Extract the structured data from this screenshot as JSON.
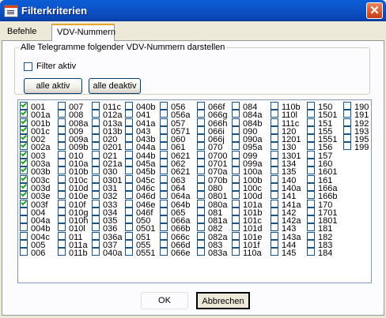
{
  "window": {
    "title": "Filterkriterien"
  },
  "tabs": [
    {
      "label": "Befehle"
    },
    {
      "label": "VDV-Nummern"
    }
  ],
  "group": {
    "label": "Alle Telegramme folgender VDV-Nummern darstellen",
    "filter_label": "Filter aktiv",
    "filter_checked": false,
    "all_on_label": "alle aktiv",
    "all_off_label": "alle deaktiv"
  },
  "vdv_columns": [
    {
      "items": [
        "001",
        "001a",
        "001b",
        "001c",
        "002",
        "002a",
        "003",
        "003a",
        "003b",
        "003c",
        "003d",
        "003e",
        "003f",
        "004",
        "004a",
        "004b",
        "004c",
        "005",
        "006"
      ],
      "checked": 13
    },
    {
      "items": [
        "007",
        "008",
        "008a",
        "009",
        "009a",
        "009b",
        "010",
        "010a",
        "010b",
        "010c",
        "010d",
        "010e",
        "010f",
        "010g",
        "010h",
        "010l",
        "011",
        "011a",
        "011b"
      ],
      "checked": 0
    },
    {
      "items": [
        "011c",
        "012a",
        "013a",
        "013b",
        "020",
        "0201",
        "021",
        "021a",
        "030",
        "0301",
        "031",
        "032",
        "033",
        "034",
        "035",
        "036",
        "036a",
        "037",
        "040a"
      ],
      "checked": 0
    },
    {
      "items": [
        "040b",
        "041",
        "041a",
        "043",
        "043b",
        "044a",
        "044b",
        "045a",
        "045b",
        "045c",
        "046c",
        "046d",
        "046e",
        "046f",
        "050",
        "0501",
        "051",
        "055",
        "0551"
      ],
      "checked": 0
    },
    {
      "items": [
        "056",
        "056a",
        "057",
        "0571",
        "060",
        "061",
        "0621",
        "062",
        "0621",
        "063",
        "064",
        "064a",
        "064b",
        "065",
        "066a",
        "066b",
        "066c",
        "066d",
        "066e"
      ],
      "checked": 0
    },
    {
      "items": [
        "066f",
        "066g",
        "066h",
        "066i",
        "066j",
        "070",
        "0700",
        "0701",
        "070a",
        "070b",
        "080",
        "0801",
        "080a",
        "081",
        "081a",
        "082",
        "082a",
        "083",
        "083a"
      ],
      "checked": 0
    },
    {
      "items": [
        "084",
        "084a",
        "084b",
        "090",
        "090a",
        "095a",
        "099",
        "099a",
        "100a",
        "100b",
        "100c",
        "100d",
        "101a",
        "101b",
        "101c",
        "101d",
        "101e",
        "101f",
        "110a"
      ],
      "checked": 0
    },
    {
      "items": [
        "110b",
        "110l",
        "111c",
        "120",
        "1201",
        "130",
        "1301",
        "134",
        "135",
        "140",
        "140a",
        "141",
        "141a",
        "142",
        "142a",
        "143",
        "143a",
        "144",
        "145"
      ],
      "checked": 0
    },
    {
      "items": [
        "150",
        "1501",
        "151",
        "155",
        "1551",
        "156",
        "157",
        "160",
        "1601",
        "161",
        "166a",
        "166b",
        "170",
        "1701",
        "1801",
        "181",
        "182",
        "183",
        "184"
      ],
      "checked": 0
    },
    {
      "items": [
        "190",
        "191",
        "192",
        "193",
        "195",
        "199"
      ],
      "checked": 0
    }
  ],
  "buttons": {
    "ok": "OK",
    "cancel": "Abbrechen"
  },
  "colors": {
    "titlebar": "#0a5fd8",
    "background": "#ece9d8",
    "checkmark": "#21a121"
  }
}
